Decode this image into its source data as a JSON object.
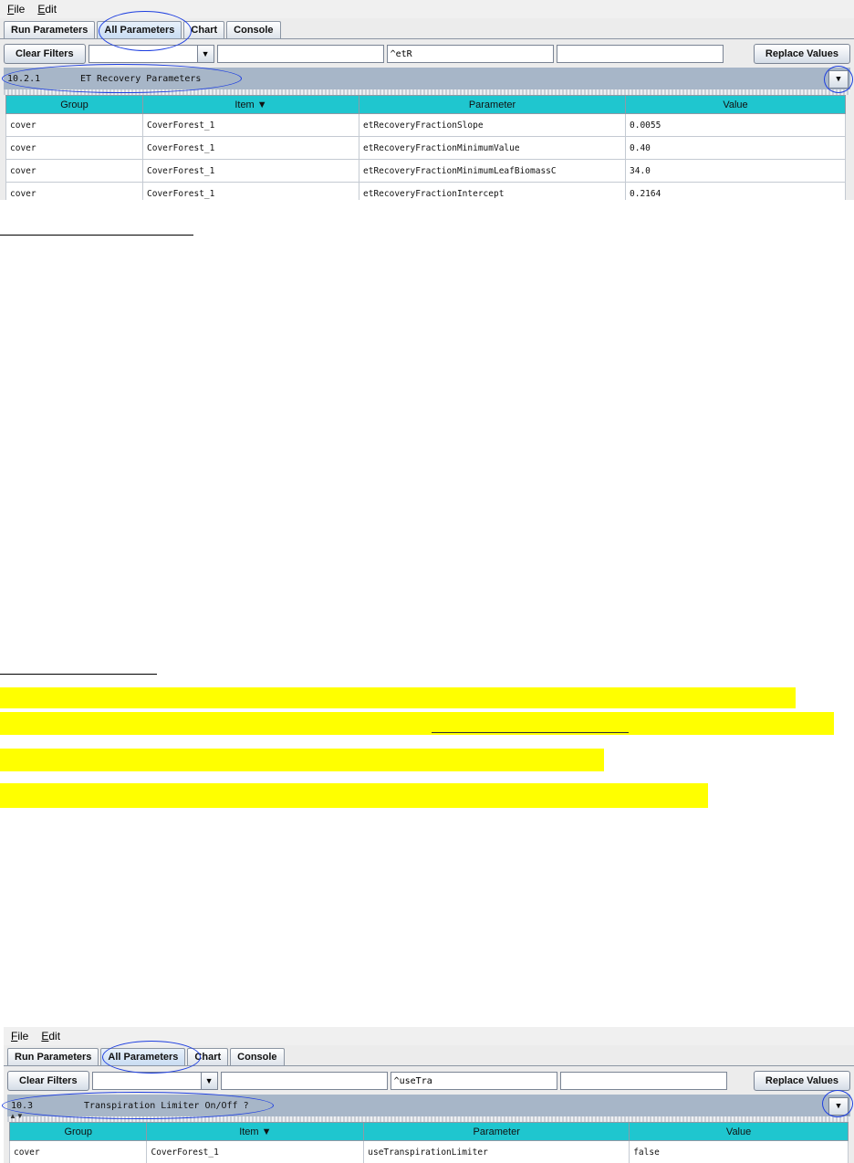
{
  "screen1": {
    "menu": [
      "File",
      "Edit"
    ],
    "tabs": [
      "Run Parameters",
      "All Parameters",
      "Chart",
      "Console"
    ],
    "clear_filters": "Clear Filters",
    "filter_text": "^etR",
    "replace_values": "Replace Values",
    "section_number": "10.2.1",
    "section_title": "ET Recovery Parameters",
    "columns": [
      "Group",
      "Item ▼",
      "Parameter",
      "Value"
    ],
    "rows": [
      [
        "cover",
        "CoverForest_1",
        "etRecoveryFractionSlope",
        "0.0055"
      ],
      [
        "cover",
        "CoverForest_1",
        "etRecoveryFractionMinimumValue",
        "0.40"
      ],
      [
        "cover",
        "CoverForest_1",
        "etRecoveryFractionMinimumLeafBiomassC",
        "34.0"
      ],
      [
        "cover",
        "CoverForest_1",
        "etRecoveryFractionIntercept",
        "0.2164"
      ]
    ]
  },
  "screen2": {
    "menu": [
      "File",
      "Edit"
    ],
    "tabs": [
      "Run Parameters",
      "All Parameters",
      "Chart",
      "Console"
    ],
    "clear_filters": "Clear Filters",
    "filter_text": "^useTra",
    "replace_values": "Replace Values",
    "section_number": "10.3",
    "section_title": "Transpiration Limiter On/Off ?",
    "columns": [
      "Group",
      "Item ▼",
      "Parameter",
      "Value"
    ],
    "rows": [
      [
        "cover",
        "CoverForest_1",
        "useTranspirationLimiter",
        "false"
      ]
    ]
  },
  "colors": {
    "highlight": "#ffff00",
    "annotation": "#1e3fe0",
    "table_header": "#1fc6cf",
    "section_bar": "#a7b6c8"
  }
}
